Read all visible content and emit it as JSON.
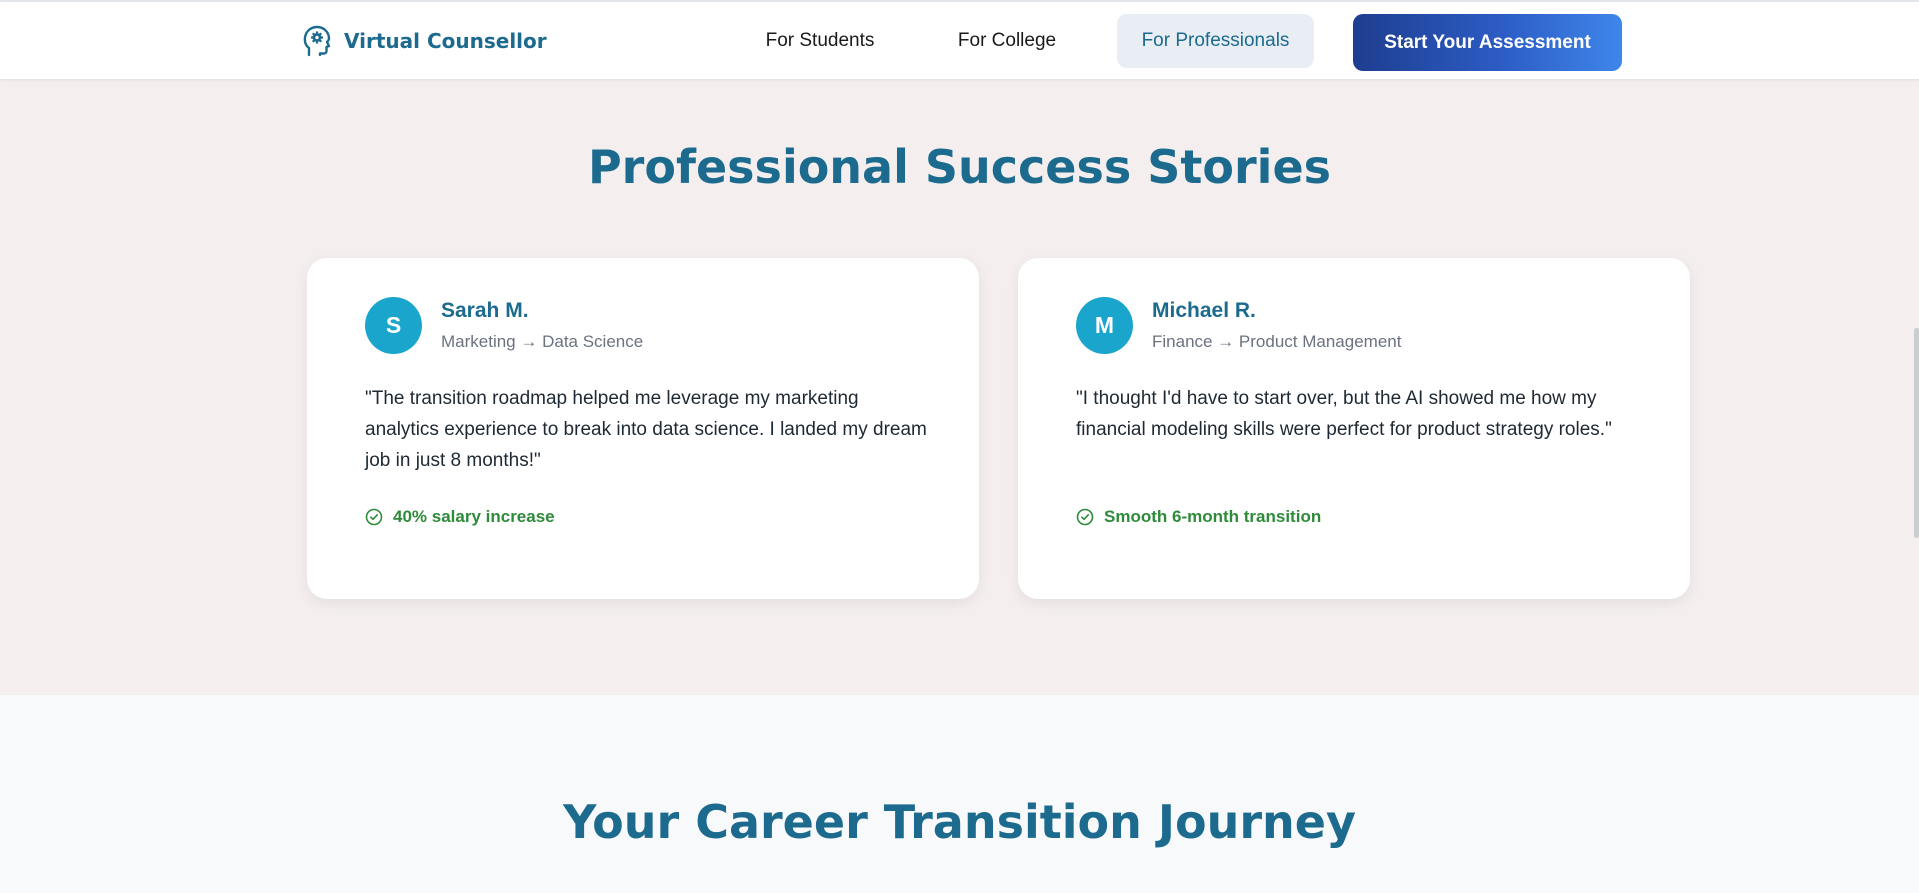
{
  "navbar": {
    "brand_name": "Virtual Counsellor",
    "brand_icon": "brain-head-icon",
    "links": [
      {
        "label": "For Students"
      },
      {
        "label": "For College"
      },
      {
        "label": "For Professionals",
        "active": true
      }
    ],
    "cta_label": "Start Your Assessment"
  },
  "success_stories": {
    "title": "Professional Success Stories",
    "stories": [
      {
        "initial": "S",
        "name": "Sarah M.",
        "role": "Marketing → Data Science",
        "quote": "\"The transition roadmap helped me leverage my marketing analytics experience to break into data science. I landed my dream job in just 8 months!\"",
        "result_icon": "check-circle-icon",
        "result": "40% salary increase"
      },
      {
        "initial": "M",
        "name": "Michael R.",
        "role": "Finance → Product Management",
        "quote": "\"I thought I'd have to start over, but the AI showed me how my financial modeling skills were perfect for product strategy roles.\"",
        "result_icon": "check-circle-icon",
        "result": "Smooth 6-month transition"
      }
    ]
  },
  "journey": {
    "title": "Your Career Transition Journey"
  },
  "colors": {
    "brand": "#1c6b8f",
    "accent_avatar": "#1aa6cc",
    "success": "#2e8b3a",
    "cta_gradient_start": "#1e3d8f",
    "cta_gradient_end": "#3f86ea",
    "section_bg": "#f4efee"
  }
}
